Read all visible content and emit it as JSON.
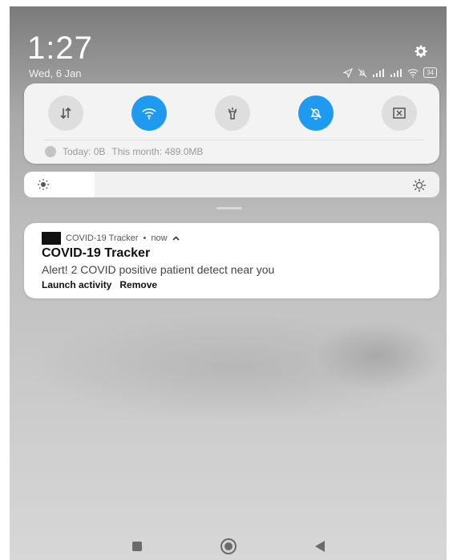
{
  "status": {
    "time": "1:27",
    "date": "Wed, 6 Jan",
    "battery": "34"
  },
  "quick_settings": {
    "tiles": [
      {
        "name": "mobile-data",
        "icon": "data-transfer-icon",
        "active": false
      },
      {
        "name": "wifi",
        "icon": "wifi-icon",
        "active": true
      },
      {
        "name": "flashlight",
        "icon": "flashlight-icon",
        "active": false
      },
      {
        "name": "silent",
        "icon": "bell-off-icon",
        "active": true
      },
      {
        "name": "screenshot",
        "icon": "screenshot-icon",
        "active": false
      }
    ],
    "data_today": "Today: 0B",
    "data_month": "This month: 489.0MB",
    "accent_color": "#1e9bf0"
  },
  "brightness": {
    "level": 0.17
  },
  "notification": {
    "app_name": "COVID-19 Tracker",
    "time": "now",
    "title": "COVID-19 Tracker",
    "body": "Alert! 2 COVID positive patient detect near you",
    "actions": [
      "Launch activity",
      "Remove"
    ]
  },
  "navbar": {
    "buttons": [
      "recents",
      "home",
      "back"
    ]
  }
}
